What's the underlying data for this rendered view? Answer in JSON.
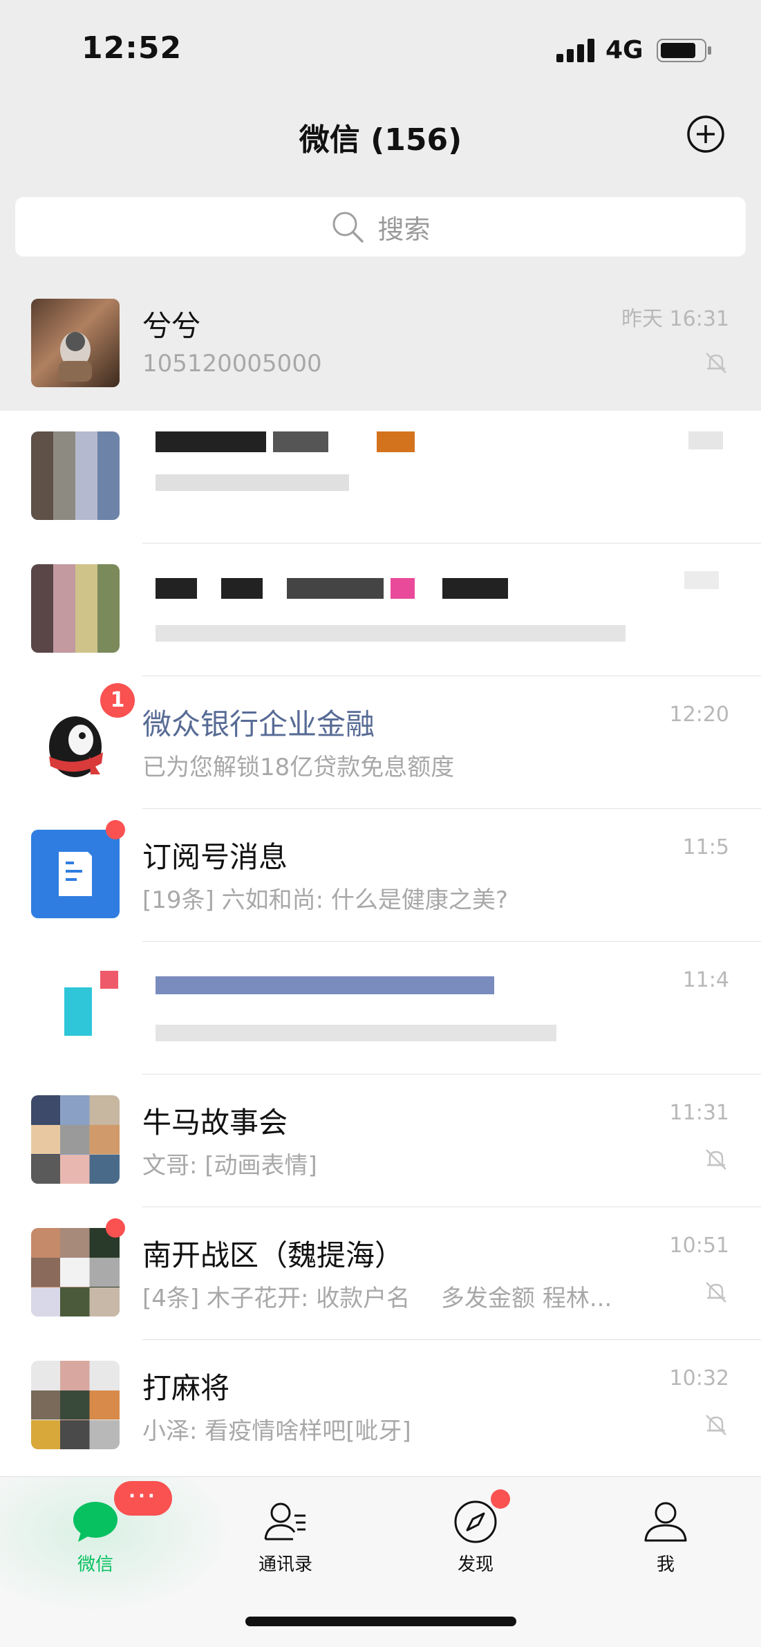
{
  "status_bar": {
    "time": "12:52",
    "network": "4G"
  },
  "header": {
    "title": "微信 (156)",
    "add_icon": "plus-circle-icon"
  },
  "search": {
    "placeholder": "搜索",
    "icon": "search-icon"
  },
  "chats": [
    {
      "name": "兮兮",
      "preview": "105120005000",
      "time": "昨天 16:31",
      "muted": true,
      "pinned": true
    },
    {
      "name": "",
      "preview": "",
      "time": "",
      "obscured": true
    },
    {
      "name": "",
      "preview": "",
      "time": "",
      "obscured": true
    },
    {
      "name": "微众银行企业金融",
      "preview": "已为您解锁18亿贷款免息额度",
      "time": "12:20",
      "badge": "1",
      "official": true
    },
    {
      "name": "订阅号消息",
      "preview": "[19条] 六如和尚: 什么是健康之美?",
      "time": "11:5",
      "dot": true
    },
    {
      "name": "",
      "preview": "",
      "time": "11:4",
      "obscured": true
    },
    {
      "name": "牛马故事会",
      "preview": "文哥: [动画表情]",
      "time": "11:31",
      "muted": true
    },
    {
      "name": "南开战区（魏提海）",
      "preview": "[4条] 木子花开: 收款户名　 多发金额 程林...",
      "time": "10:51",
      "muted": true,
      "dot": true
    },
    {
      "name": "打麻将",
      "preview": "小泽: 看疫情啥样吧[呲牙]",
      "time": "10:32",
      "muted": true
    }
  ],
  "tabs": [
    {
      "label": "微信",
      "icon": "chat-bubble-icon",
      "active": true,
      "badge": "···"
    },
    {
      "label": "通讯录",
      "icon": "contacts-icon"
    },
    {
      "label": "发现",
      "icon": "compass-icon",
      "dot": true
    },
    {
      "label": "我",
      "icon": "person-icon"
    }
  ],
  "colors": {
    "accent": "#07c160",
    "badge": "#fa5151",
    "official_name": "#576b95"
  }
}
